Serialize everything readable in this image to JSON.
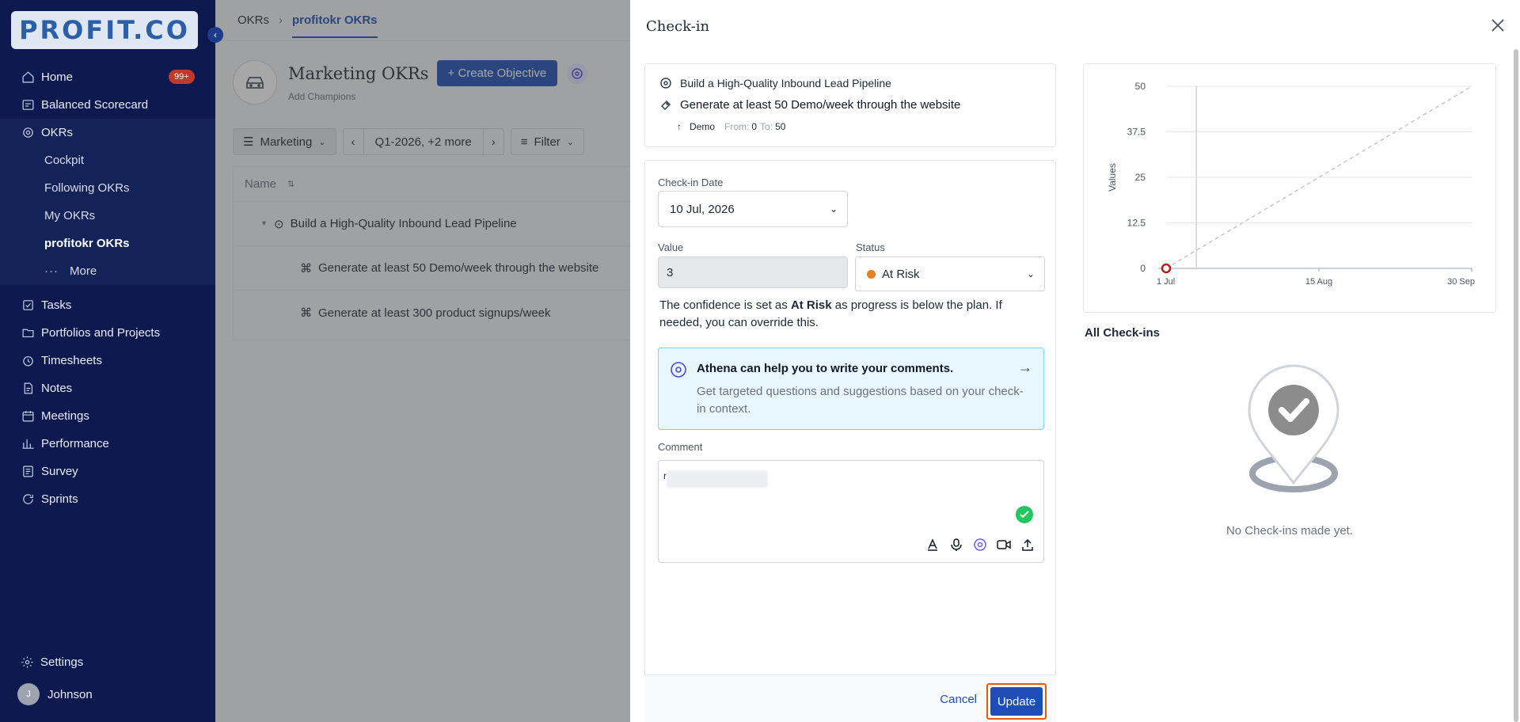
{
  "brand": {
    "logo": "PROFIT.CO"
  },
  "sidebar": {
    "items": [
      {
        "label": "Home",
        "icon": "home-icon",
        "badge": "99+"
      },
      {
        "label": "Balanced Scorecard",
        "icon": "scorecard-icon"
      },
      {
        "label": "OKRs",
        "icon": "target-icon"
      },
      {
        "label": "Cockpit"
      },
      {
        "label": "Following OKRs"
      },
      {
        "label": "My OKRs"
      },
      {
        "label": "profitokr OKRs"
      },
      {
        "label": "More"
      },
      {
        "label": "Tasks",
        "icon": "tasks-icon"
      },
      {
        "label": "Portfolios and Projects",
        "icon": "folder-icon"
      },
      {
        "label": "Timesheets",
        "icon": "clock-icon"
      },
      {
        "label": "Notes",
        "icon": "note-icon"
      },
      {
        "label": "Meetings",
        "icon": "calendar-icon"
      },
      {
        "label": "Performance",
        "icon": "performance-icon"
      },
      {
        "label": "Survey",
        "icon": "survey-icon"
      },
      {
        "label": "Sprints",
        "icon": "sprint-icon"
      }
    ],
    "settings": "Settings",
    "user": {
      "initial": "J",
      "name": "Johnson"
    }
  },
  "main": {
    "breadcrumb": {
      "root": "OKRs",
      "current": "profitokr OKRs"
    },
    "title": "Marketing OKRs",
    "create_label": "Create Objective",
    "add_champions": "Add Champions",
    "filters": {
      "team": "Marketing",
      "period": "Q1-2026, +2 more",
      "filter": "Filter"
    },
    "table": {
      "header": "Name",
      "rows": [
        "Build a High-Quality Inbound Lead Pipeline",
        "Generate at least 50 Demo/week through the website",
        "Generate at least 300 product signups/week"
      ]
    }
  },
  "checkin": {
    "title": "Check-in",
    "objective": "Build a High-Quality Inbound Lead Pipeline",
    "key_result": "Generate at least 50 Demo/week through the website",
    "metric": {
      "name": "Demo",
      "from_label": "From:",
      "from": "0",
      "to_label": "To:",
      "to": "50"
    },
    "date_label": "Check-in Date",
    "date": "10 Jul, 2026",
    "value_label": "Value",
    "value": "3",
    "status_label": "Status",
    "status": "At Risk",
    "status_color": "#e67e22",
    "confidence_pre": "The confidence is set as ",
    "confidence_bold": "At Risk",
    "confidence_post": " as progress is below the plan. If needed, you can override this.",
    "athena_title": "Athena can help you to write your comments.",
    "athena_desc": "Get targeted questions and suggestions based on your check-in context.",
    "comment_label": "Comment",
    "comment_start": "r",
    "cancel": "Cancel",
    "update": "Update",
    "all_checkins": "All Check-ins",
    "empty": "No Check-ins made yet."
  },
  "chart_data": {
    "type": "line",
    "ylabel": "Values",
    "x_ticks": [
      "1 Jul",
      "15 Aug",
      "30 Sep"
    ],
    "y_ticks": [
      0,
      12.5,
      25,
      37.5,
      50
    ],
    "ylim": [
      0,
      50
    ],
    "plan_line": {
      "start": [
        "1 Jul",
        0
      ],
      "end": [
        "30 Sep",
        50
      ],
      "style": "dashed"
    },
    "current_marker": {
      "x": "10 Jul",
      "note": "vertical line at check-in date"
    },
    "points": [
      {
        "x": "1 Jul",
        "y": 0
      }
    ]
  }
}
